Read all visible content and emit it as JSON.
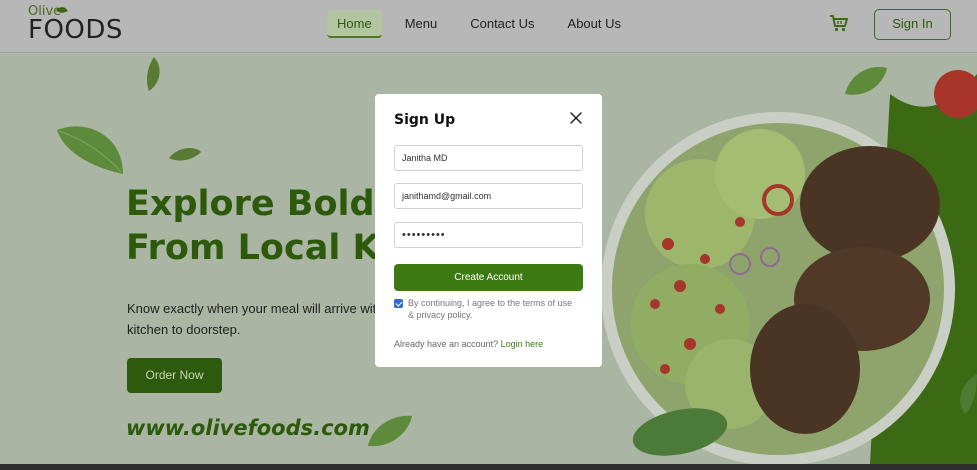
{
  "brand": {
    "logo_top": "Olive",
    "logo_bottom": "FOODS"
  },
  "nav": {
    "items": [
      "Home",
      "Menu",
      "Contact Us",
      "About Us"
    ],
    "active": "Home"
  },
  "header": {
    "signin_label": "Sign In",
    "cart_icon": "cart-icon"
  },
  "hero": {
    "title_line1": "Explore Bold N",
    "title_line2": "From Local Kit",
    "description_line1": "Know exactly when your meal will arrive with",
    "description_line2": "kitchen to doorstep.",
    "order_label": "Order Now",
    "website": "www.olivefoods.com"
  },
  "modal": {
    "title": "Sign Up",
    "name_value": "Janitha MD",
    "email_value": "janithamd@gmail.com",
    "password_mask": "•••••••••",
    "create_label": "Create Account",
    "terms_line1": "By continuing, I agree to the terms of use",
    "terms_line2": "& privacy policy.",
    "already_text": "Already have an account?",
    "login_link": "Login here",
    "checkbox_checked": true
  },
  "colors": {
    "accent": "#2d5a0c",
    "button": "#3d7a12",
    "overlay": "#b7b7b7"
  }
}
